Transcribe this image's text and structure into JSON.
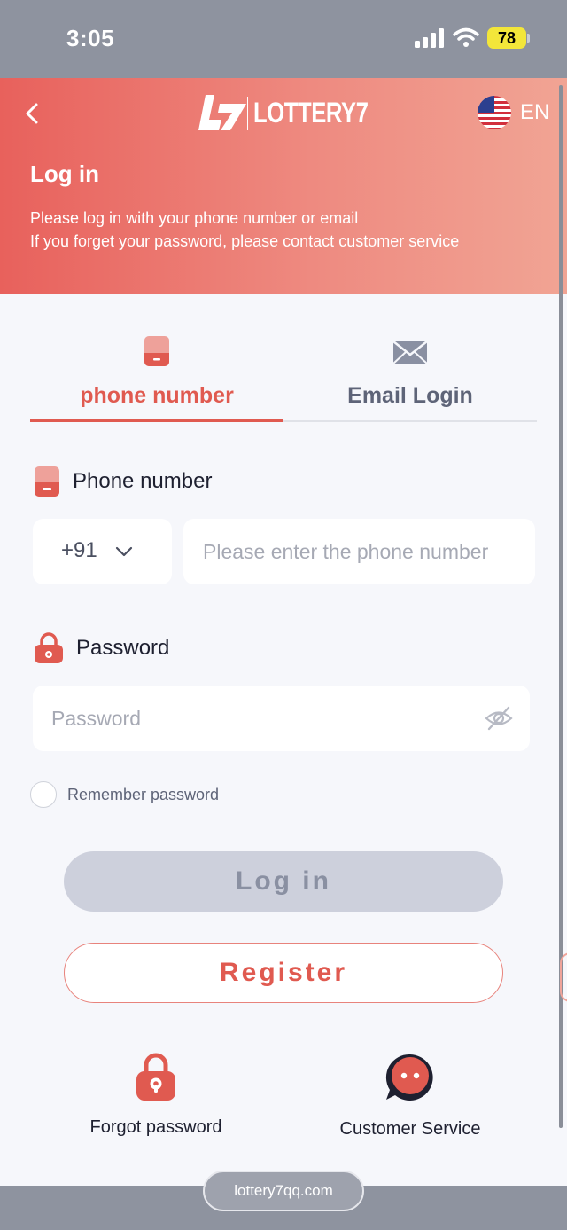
{
  "status_bar": {
    "time": "3:05",
    "battery": "78"
  },
  "header": {
    "logo_text": "LOTTERY7",
    "language": "EN",
    "title": "Log in",
    "desc_line1": "Please log in with your phone number or email",
    "desc_line2": "If you forget your password, please contact customer service"
  },
  "tabs": [
    {
      "label": "phone number",
      "active": true
    },
    {
      "label": "Email Login",
      "active": false
    }
  ],
  "form": {
    "phone_label": "Phone number",
    "country_code": "+91",
    "phone_placeholder": "Please enter the phone number",
    "password_label": "Password",
    "password_placeholder": "Password",
    "remember_label": "Remember password"
  },
  "buttons": {
    "login": "Log in",
    "register": "Register"
  },
  "bottom_links": {
    "forgot": "Forgot password",
    "service": "Customer Service"
  },
  "url_bar": "lottery7qq.com",
  "colors": {
    "accent": "#e05a50",
    "header_start": "#e8615c",
    "header_end": "#f1a494",
    "disabled_btn": "#cdd0dc"
  }
}
